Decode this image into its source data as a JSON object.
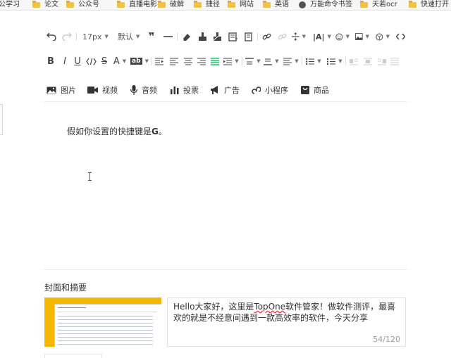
{
  "bookmarks": [
    {
      "label": "公学习",
      "icon": "none"
    },
    {
      "label": "论文",
      "icon": "folder-icon"
    },
    {
      "label": "公众号",
      "icon": "folder-icon"
    },
    {
      "label": "直播电影",
      "icon": "folder-icon"
    },
    {
      "label": "破解",
      "icon": "folder-icon"
    },
    {
      "label": "捷径",
      "icon": "folder-icon"
    },
    {
      "label": "网站",
      "icon": "folder-icon"
    },
    {
      "label": "英语",
      "icon": "folder-icon"
    },
    {
      "label": "万能命令书签",
      "icon": "globe-icon"
    },
    {
      "label": "天若ocr",
      "icon": "folder-icon"
    },
    {
      "label": "快速打开",
      "icon": "folder-icon"
    }
  ],
  "toolbar": {
    "font_size": "17px",
    "font_family": "默认"
  },
  "insert_bar": [
    {
      "label": "图片",
      "icon": "image-icon"
    },
    {
      "label": "视频",
      "icon": "video-icon"
    },
    {
      "label": "音频",
      "icon": "microphone-icon"
    },
    {
      "label": "投票",
      "icon": "vote-chart-icon"
    },
    {
      "label": "广告",
      "icon": "megaphone-icon"
    },
    {
      "label": "小程序",
      "icon": "mini-program-icon"
    },
    {
      "label": "商品",
      "icon": "product-icon"
    }
  ],
  "editor": {
    "text_before": "假如你设置的快捷键是",
    "bold_key": "G",
    "text_after": "。"
  },
  "cover_section": {
    "title": "封面和摘要",
    "summary_pre": "Hello大家好，这里是",
    "summary_brand": "TopOne",
    "summary_post": "软件管家！做软件测评，最喜欢的就是不经意间遇到一款高效率的软件，今天分享",
    "counter": "54/120"
  },
  "colors": {
    "accent_green": "#07c160",
    "cover_bg": "#f5b800",
    "folder": "#f0c24a"
  }
}
